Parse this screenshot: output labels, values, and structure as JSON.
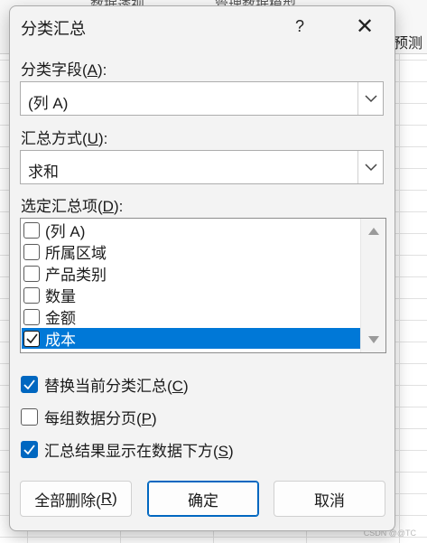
{
  "background": {
    "ribbon_fragments": [
      "数据透视",
      "管理数据模型"
    ],
    "ribbon_predict": "预测",
    "watermark": "CSDN @@TC"
  },
  "dialog": {
    "title": "分类汇总",
    "help_label": "?",
    "close_label": "✕",
    "group_field": {
      "label_prefix": "分类字段(",
      "label_key": "A",
      "label_suffix": "):",
      "value": "(列 A)"
    },
    "summary_method": {
      "label_prefix": "汇总方式(",
      "label_key": "U",
      "label_suffix": "):",
      "value": "求和"
    },
    "summary_items": {
      "label_prefix": "选定汇总项(",
      "label_key": "D",
      "label_suffix": "):",
      "items": [
        {
          "label": "(列 A)",
          "checked": false,
          "selected": false
        },
        {
          "label": "所属区域",
          "checked": false,
          "selected": false
        },
        {
          "label": "产品类别",
          "checked": false,
          "selected": false
        },
        {
          "label": "数量",
          "checked": false,
          "selected": false
        },
        {
          "label": "金额",
          "checked": false,
          "selected": false
        },
        {
          "label": "成本",
          "checked": true,
          "selected": true
        }
      ]
    },
    "options": [
      {
        "label_prefix": "替换当前分类汇总(",
        "label_key": "C",
        "label_suffix": ")",
        "checked": true
      },
      {
        "label_prefix": "每组数据分页(",
        "label_key": "P",
        "label_suffix": ")",
        "checked": false
      },
      {
        "label_prefix": "汇总结果显示在数据下方(",
        "label_key": "S",
        "label_suffix": ")",
        "checked": true
      }
    ],
    "buttons": {
      "delete_all_prefix": "全部删除(",
      "delete_all_key": "R",
      "delete_all_suffix": ")",
      "ok": "确定",
      "cancel": "取消"
    }
  }
}
